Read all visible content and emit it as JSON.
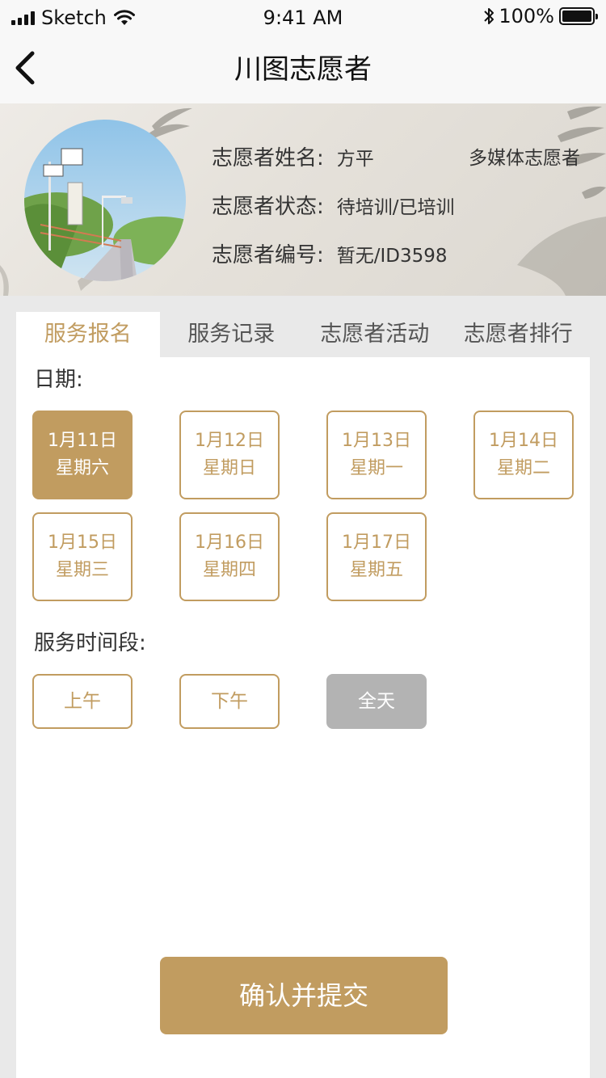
{
  "status_bar": {
    "carrier": "Sketch",
    "time": "9:41 AM",
    "battery": "100%"
  },
  "nav": {
    "title": "川图志愿者"
  },
  "profile": {
    "name_label": "志愿者姓名:",
    "name_value": "方平",
    "role": "多媒体志愿者",
    "status_label": "志愿者状态:",
    "status_value": "待培训/已培训",
    "id_label": "志愿者编号:",
    "id_value": "暂无/ID3598"
  },
  "tabs": [
    {
      "label": "服务报名",
      "active": true
    },
    {
      "label": "服务记录",
      "active": false
    },
    {
      "label": "志愿者活动",
      "active": false
    },
    {
      "label": "志愿者排行",
      "active": false
    }
  ],
  "form": {
    "date_label": "日期:",
    "dates": [
      {
        "date": "1月11日",
        "weekday": "星期六",
        "selected": true
      },
      {
        "date": "1月12日",
        "weekday": "星期日",
        "selected": false
      },
      {
        "date": "1月13日",
        "weekday": "星期一",
        "selected": false
      },
      {
        "date": "1月14日",
        "weekday": "星期二",
        "selected": false
      },
      {
        "date": "1月15日",
        "weekday": "星期三",
        "selected": false
      },
      {
        "date": "1月16日",
        "weekday": "星期四",
        "selected": false
      },
      {
        "date": "1月17日",
        "weekday": "星期五",
        "selected": false
      }
    ],
    "time_label": "服务时间段:",
    "time_slots": [
      {
        "label": "上午",
        "state": "available"
      },
      {
        "label": "下午",
        "state": "available"
      },
      {
        "label": "全天",
        "state": "disabled"
      }
    ],
    "submit_label": "确认并提交"
  },
  "colors": {
    "accent": "#c19c60",
    "disabled": "#b3b3b3",
    "background": "#e9e9e9"
  }
}
